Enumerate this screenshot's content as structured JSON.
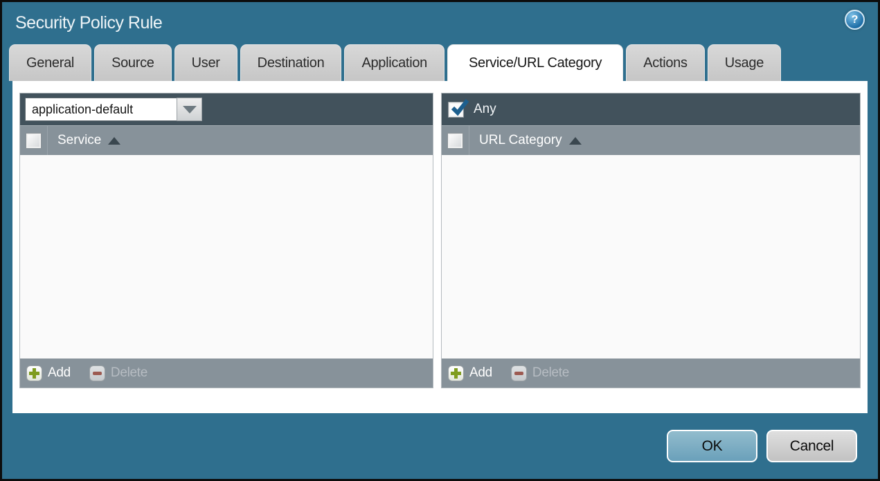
{
  "window": {
    "title": "Security Policy Rule"
  },
  "icons": {
    "help": "?"
  },
  "tabs": [
    {
      "label": "General"
    },
    {
      "label": "Source"
    },
    {
      "label": "User"
    },
    {
      "label": "Destination"
    },
    {
      "label": "Application"
    },
    {
      "label": "Service/URL Category"
    },
    {
      "label": "Actions"
    },
    {
      "label": "Usage"
    }
  ],
  "active_tab": "Service/URL Category",
  "service_panel": {
    "service_type_value": "application-default",
    "column_header": "Service",
    "sort_order": "ascending",
    "rows": [],
    "add_label": "Add",
    "delete_label": "Delete",
    "delete_enabled": false
  },
  "url_category_panel": {
    "any_label": "Any",
    "any_checked": true,
    "column_header": "URL Category",
    "sort_order": "ascending",
    "rows": [],
    "add_label": "Add",
    "delete_label": "Delete",
    "delete_enabled": false
  },
  "footer": {
    "ok_label": "OK",
    "cancel_label": "Cancel"
  },
  "colors": {
    "chrome_teal": "#2f6f8e",
    "bar_dark_slate": "#42525c",
    "bar_gray": "#87929a",
    "list_bg": "#fafafa",
    "active_tab_bg": "#ffffff",
    "inactive_tab_bg": "#cccccc",
    "ok_button_bg": "#79aac2",
    "cancel_button_bg": "#cccccc",
    "add_plus_green": "#7f9c1f",
    "delete_minus_red": "#9c5a51",
    "checkmark_blue": "#1d5f8e"
  }
}
